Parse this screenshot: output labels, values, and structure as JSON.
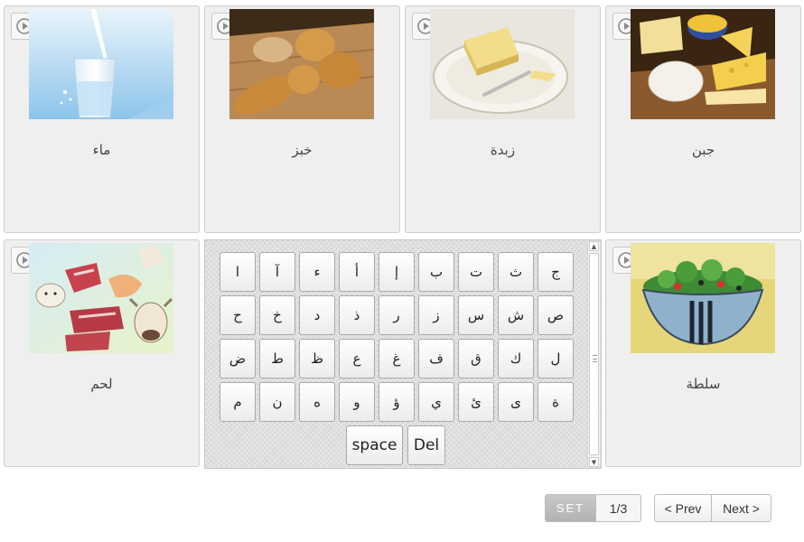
{
  "cards": [
    {
      "word": "ماء",
      "image": "glass-of-water"
    },
    {
      "word": "خبز",
      "image": "bread-loaves"
    },
    {
      "word": "زبدة",
      "image": "butter-on-plate"
    },
    {
      "word": "جبن",
      "image": "cheese-assortment"
    },
    {
      "word": "لحم",
      "image": "meat-and-animals"
    },
    {
      "word": "سلطة",
      "image": "salad-bowl"
    }
  ],
  "keyboard": {
    "rows": [
      [
        "ا",
        "آ",
        "ء",
        "أ",
        "إ",
        "ب",
        "ت",
        "ث",
        "ج"
      ],
      [
        "ح",
        "خ",
        "د",
        "ذ",
        "ر",
        "ز",
        "س",
        "ش",
        "ص"
      ],
      [
        "ض",
        "ط",
        "ظ",
        "ع",
        "غ",
        "ف",
        "ق",
        "ك",
        "ل"
      ],
      [
        "م",
        "ن",
        "ه",
        "و",
        "ؤ",
        "ي",
        "ئ",
        "ى",
        "ة"
      ]
    ],
    "space_label": "space",
    "del_label": "Del"
  },
  "pager": {
    "set_label": "SET",
    "count": "1/3",
    "prev_label": "< Prev",
    "next_label": "Next >"
  },
  "colors": {
    "card_bg": "#efefef",
    "card_border": "#cfcfcf",
    "keyboard_bg": "#d9d9d9"
  }
}
